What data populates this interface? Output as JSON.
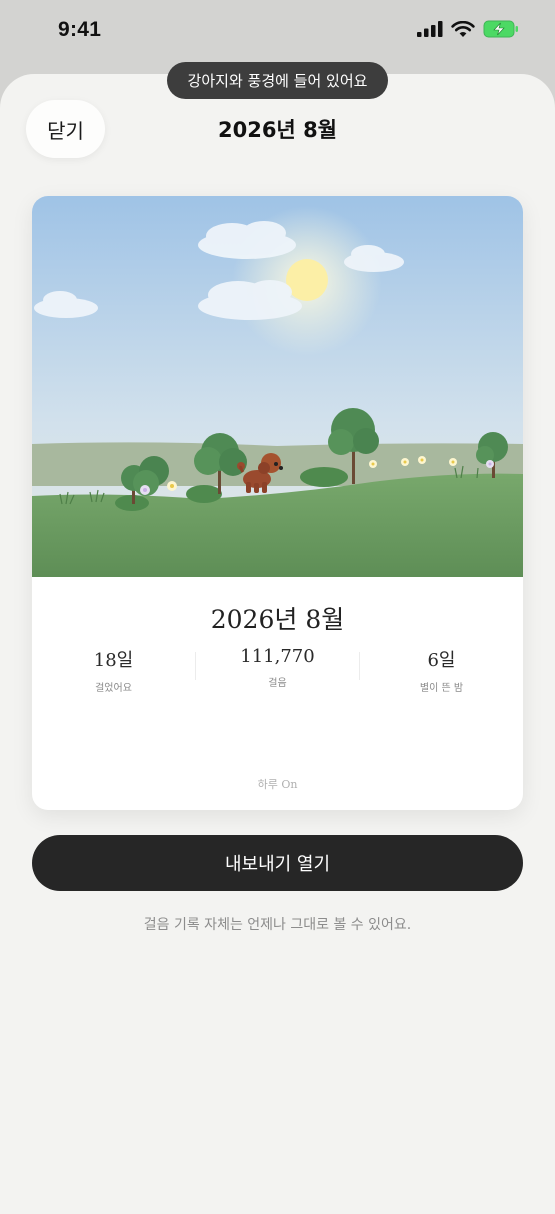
{
  "status_bar": {
    "time": "9:41"
  },
  "toast": {
    "text": "강아지와 풍경에 들어 있어요"
  },
  "header": {
    "close_label": "닫기",
    "title": "2026년 8월"
  },
  "card": {
    "title": "2026년 8월",
    "stats": [
      {
        "value": "18일",
        "label": "걸었어요"
      },
      {
        "value": "111,770",
        "label": "걸음"
      },
      {
        "value": "6일",
        "label": "별이 뜬 밤"
      }
    ],
    "brand": "하루 On"
  },
  "export_button": {
    "label": "내보내기 열기"
  },
  "footnote": "걸음 기록 자체는 언제나 그대로 볼 수 있어요.",
  "colors": {
    "accent_dark": "#262626",
    "sky": "#a9c8e6",
    "grass": "#6f9e64"
  },
  "icons": [
    "signal-icon",
    "wifi-icon",
    "battery-charging-icon",
    "dog-illustration",
    "sun-icon"
  ]
}
